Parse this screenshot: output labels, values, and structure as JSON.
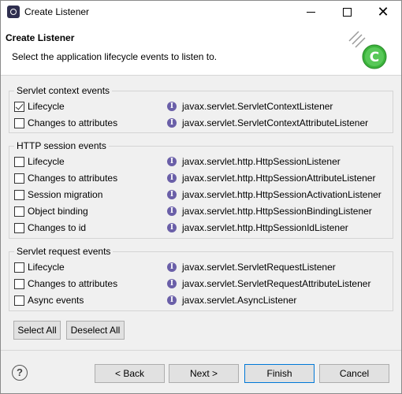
{
  "window": {
    "title": "Create Listener"
  },
  "header": {
    "title": "Create Listener",
    "description": "Select the application lifecycle events to listen to."
  },
  "groups": [
    {
      "legend": "Servlet context events",
      "items": [
        {
          "label": "Lifecycle",
          "checked": true,
          "interface": "javax.servlet.ServletContextListener"
        },
        {
          "label": "Changes to attributes",
          "checked": false,
          "interface": "javax.servlet.ServletContextAttributeListener"
        }
      ]
    },
    {
      "legend": "HTTP session events",
      "items": [
        {
          "label": "Lifecycle",
          "checked": false,
          "interface": "javax.servlet.http.HttpSessionListener"
        },
        {
          "label": "Changes to attributes",
          "checked": false,
          "interface": "javax.servlet.http.HttpSessionAttributeListener"
        },
        {
          "label": "Session migration",
          "checked": false,
          "interface": "javax.servlet.http.HttpSessionActivationListener"
        },
        {
          "label": "Object binding",
          "checked": false,
          "interface": "javax.servlet.http.HttpSessionBindingListener"
        },
        {
          "label": "Changes to id",
          "checked": false,
          "interface": "javax.servlet.http.HttpSessionIdListener"
        }
      ]
    },
    {
      "legend": "Servlet request events",
      "items": [
        {
          "label": "Lifecycle",
          "checked": false,
          "interface": "javax.servlet.ServletRequestListener"
        },
        {
          "label": "Changes to attributes",
          "checked": false,
          "interface": "javax.servlet.ServletRequestAttributeListener"
        },
        {
          "label": "Async events",
          "checked": false,
          "interface": "javax.servlet.AsyncListener"
        }
      ]
    }
  ],
  "selection": {
    "select_all": "Select All",
    "deselect_all": "Deselect All"
  },
  "footer": {
    "help_icon": "question-mark",
    "back": "< Back",
    "next": "Next >",
    "finish": "Finish",
    "cancel": "Cancel"
  },
  "icons": {
    "interface": "interface-i",
    "logo": "wizard-listener-logo"
  },
  "colors": {
    "accent": "#0078d7",
    "interface_icon": "#6a5fa8",
    "logo_green": "#3cb33c"
  }
}
